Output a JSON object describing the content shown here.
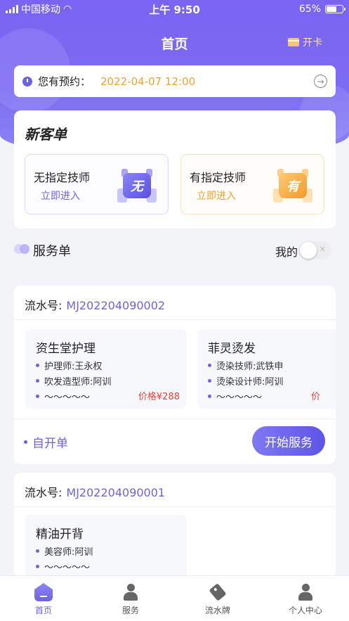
{
  "status_bar": {
    "carrier": "中国移动",
    "time": "上午 9:50",
    "battery": "65%",
    "battery_level": 0.65
  },
  "nav": {
    "title": "首页",
    "open_card_label": "开卡"
  },
  "appointment": {
    "label": "您有预约：",
    "time": "2022-04-07 12:00"
  },
  "new_order": {
    "title": "新客单",
    "cards": [
      {
        "title": "无指定技师",
        "action": "立即进入",
        "badge": "无"
      },
      {
        "title": "有指定技师",
        "action": "立即进入",
        "badge": "有"
      }
    ]
  },
  "service_orders": {
    "title": "服务单",
    "mine_label": "我的",
    "mine_toggle": false,
    "toggle_symbol": "✕"
  },
  "orders": [
    {
      "no_label": "流水号:",
      "no": "MJ202204090002",
      "items": [
        {
          "name": "资生堂护理",
          "lines": [
            "护理师:王永权",
            "吹发造型师:阿训",
            "～～～～～"
          ],
          "price": "价格¥288"
        },
        {
          "name": "菲灵烫发",
          "lines": [
            "烫染技师:武铁申",
            "烫染设计师:阿训",
            "～～～～～"
          ],
          "price": "价"
        }
      ],
      "self_open": "自开单",
      "start_button": "开始服务"
    },
    {
      "no_label": "流水号:",
      "no": "MJ202204090001",
      "items": [
        {
          "name": "精油开背",
          "lines": [
            "美容师:阿训",
            "～～～～～"
          ]
        }
      ]
    }
  ],
  "tabbar": [
    {
      "label": "首页",
      "icon": "home-icon",
      "active": true
    },
    {
      "label": "服务",
      "icon": "person-icon",
      "active": false
    },
    {
      "label": "流水牌",
      "icon": "tag-icon",
      "active": false
    },
    {
      "label": "个人中心",
      "icon": "profile-icon",
      "active": false
    }
  ],
  "colors": {
    "brand": "#6d63e0",
    "accent_orange": "#f0a22a",
    "price_red": "#e2453b"
  }
}
